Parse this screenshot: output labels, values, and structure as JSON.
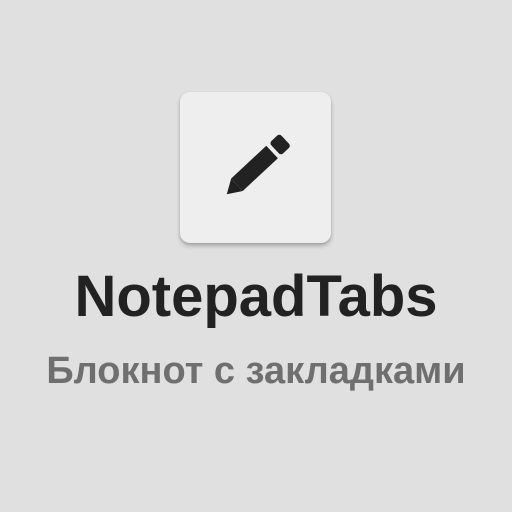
{
  "app": {
    "icon": "pencil-icon",
    "title": "NotepadTabs",
    "subtitle": "Блокнот с закладками"
  },
  "colors": {
    "background": "#e0e0e0",
    "tile": "#eeeeee",
    "icon": "#222222",
    "title": "#222222",
    "subtitle": "#6f6f6f"
  }
}
